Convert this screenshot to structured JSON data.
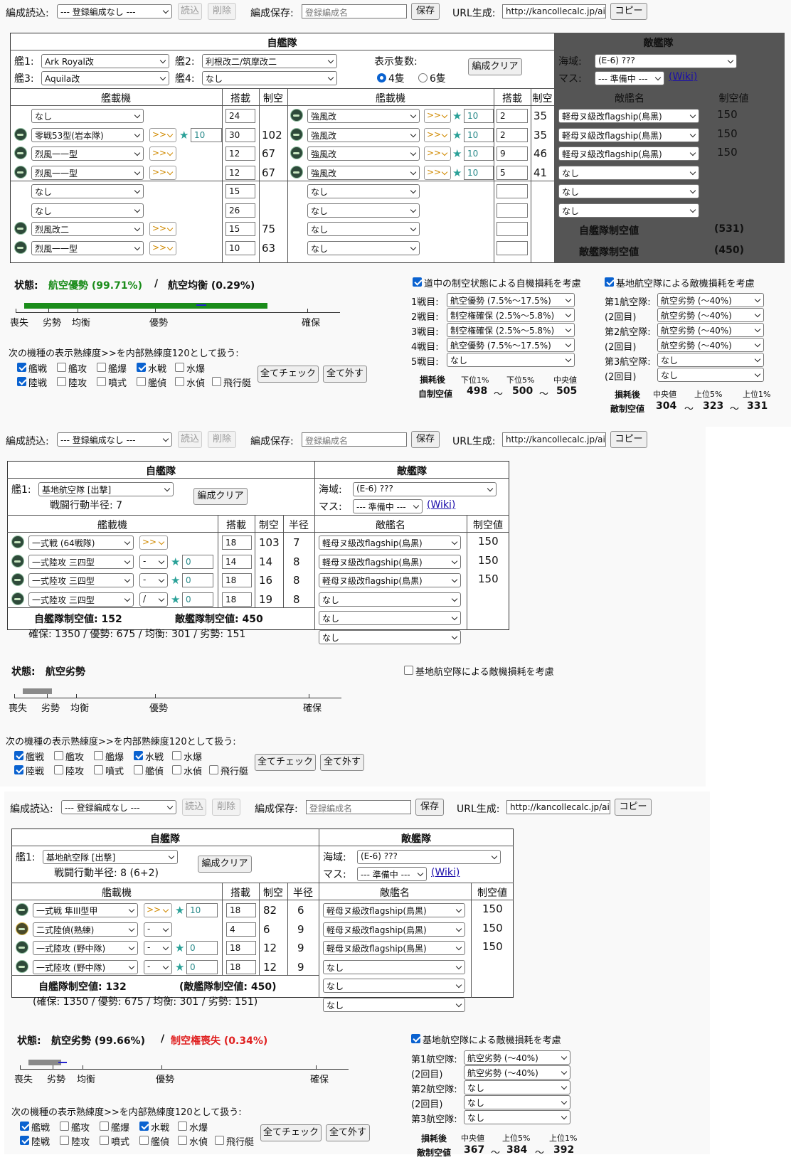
{
  "top_bar": {
    "load_label": "編成読込:",
    "load_select": "--- 登録編成なし ---",
    "read": "読込",
    "delete": "削除",
    "save_label": "編成保存:",
    "save_placeholder": "登録編成名",
    "save": "保存",
    "url_label": "URL生成:",
    "url_value": "http://kancollecalc.jp/air_",
    "copy": "コピー"
  },
  "common": {
    "own": "自艦隊",
    "enemy": "敵艦隊",
    "equip": "艦載機",
    "slot": "搭載",
    "ap": "制空",
    "radius": "半径",
    "enemy_name": "敵艦名",
    "enemy_ap": "制空値",
    "area_label": "海域:",
    "area": "(E-6) ???",
    "cell_label": "マス:",
    "cell": "--- 準備中 ---",
    "wiki": "(Wiki)",
    "clear": "編成クリア",
    "prof_note": "次の機種の表示熟練度>>を内部熟練度120として扱う:",
    "check_all": "全てチェック",
    "uncheck_all": "全て外す",
    "status_label": "状態:",
    "star": "★",
    "lvl_max": ">>",
    "lvl_none": "-",
    "lvl_one": "/"
  },
  "checkboxes": [
    {
      "label": "艦戦",
      "on": true
    },
    {
      "label": "艦攻",
      "on": false
    },
    {
      "label": "艦爆",
      "on": false
    },
    {
      "label": "水戦",
      "on": true
    },
    {
      "label": "水爆",
      "on": false
    },
    {
      "label": "陸戦",
      "on": true
    },
    {
      "label": "陸攻",
      "on": false
    },
    {
      "label": "噴式",
      "on": false
    },
    {
      "label": "艦偵",
      "on": false
    },
    {
      "label": "水偵",
      "on": false
    },
    {
      "label": "飛行艇",
      "on": false
    }
  ],
  "scale_labels": [
    "喪失",
    "劣勢",
    "均衡",
    "優勢",
    "確保"
  ],
  "panel1": {
    "ship1_label": "艦1:",
    "ship1": "Ark Royal改",
    "ship2_label": "艦2:",
    "ship2": "利根改二/筑摩改二",
    "ship3_label": "艦3:",
    "ship3": "Aquila改",
    "ship4_label": "艦4:",
    "ship4": "なし",
    "display_count": "表示隻数:",
    "opt4": "4隻",
    "opt6": "6隻",
    "left_rows": [
      {
        "eq": "なし",
        "slot": "24",
        "ap": ""
      },
      {
        "eq": "零戦53型(岩本隊)",
        "slot": "30",
        "ap": "102",
        "lv": ">>",
        "star": "10"
      },
      {
        "eq": "烈風一一型",
        "slot": "12",
        "ap": "67",
        "lv": ">>"
      },
      {
        "eq": "烈風一一型",
        "slot": "12",
        "ap": "67",
        "lv": ">>"
      },
      {
        "eq": "なし",
        "slot": "15",
        "ap": ""
      },
      {
        "eq": "なし",
        "slot": "26",
        "ap": ""
      },
      {
        "eq": "烈風改二",
        "slot": "15",
        "ap": "75",
        "lv": ">>"
      },
      {
        "eq": "烈風一一型",
        "slot": "10",
        "ap": "63",
        "lv": ">>"
      }
    ],
    "mid_rows": [
      {
        "eq": "強風改",
        "slot": "2",
        "ap": "35",
        "lv": ">>",
        "star": "10"
      },
      {
        "eq": "強風改",
        "slot": "2",
        "ap": "35",
        "lv": ">>",
        "star": "10"
      },
      {
        "eq": "強風改",
        "slot": "9",
        "ap": "46",
        "lv": ">>",
        "star": "10"
      },
      {
        "eq": "強風改",
        "slot": "5",
        "ap": "41",
        "lv": ">>",
        "star": "10"
      },
      {
        "eq": "なし",
        "slot": "",
        "ap": ""
      },
      {
        "eq": "なし",
        "slot": "",
        "ap": ""
      },
      {
        "eq": "なし",
        "slot": "",
        "ap": ""
      },
      {
        "eq": "なし",
        "slot": "",
        "ap": ""
      }
    ],
    "enemy_rows": [
      {
        "name": "軽母ヌ級改flagship(鳥黒)",
        "ap": "150"
      },
      {
        "name": "軽母ヌ級改flagship(鳥黒)",
        "ap": "150"
      },
      {
        "name": "軽母ヌ級改flagship(鳥黒)",
        "ap": "150"
      },
      {
        "name": "なし",
        "ap": ""
      },
      {
        "name": "なし",
        "ap": ""
      },
      {
        "name": "なし",
        "ap": ""
      }
    ],
    "own_total_label": "自艦隊制空値",
    "own_total": "(531)",
    "enemy_total_label": "敵艦隊制空値",
    "enemy_total": "(450)",
    "status_green": "航空優勢 (99.71%)",
    "status_sep": " / ",
    "status_dark": "航空均衡 (0.29%)",
    "progress": 0.75,
    "route_check": "道中の制空状態による自機損耗を考慮",
    "route_rows": [
      {
        "l": "1戦目:",
        "v": "航空優勢 (7.5%〜17.5%)"
      },
      {
        "l": "2戦目:",
        "v": "制空権確保 (2.5%〜5.8%)"
      },
      {
        "l": "3戦目:",
        "v": "制空権確保 (2.5%〜5.8%)"
      },
      {
        "l": "4戦目:",
        "v": "航空優勢 (7.5%〜17.5%)"
      },
      {
        "l": "5戦目:",
        "v": "なし"
      }
    ],
    "loss_label": "損耗後",
    "own_after": "自制空値",
    "p1": "下位1%",
    "p5": "下位5%",
    "med": "中央値",
    "v1": "498",
    "v2": "500",
    "v3": "505",
    "tilde": "〜",
    "base_check": "基地航空隊による敵機損耗を考慮",
    "base_rows": [
      {
        "l": "第1航空隊:",
        "v": "航空劣勢 (〜40%)"
      },
      {
        "l": "(2回目)",
        "v": "航空劣勢 (〜40%)"
      },
      {
        "l": "第2航空隊:",
        "v": "航空劣勢 (〜40%)"
      },
      {
        "l": "(2回目)",
        "v": "航空劣勢 (〜40%)"
      },
      {
        "l": "第3航空隊:",
        "v": "なし"
      },
      {
        "l": "(2回目)",
        "v": "なし"
      }
    ],
    "enemy_after": "敵制空値",
    "u5": "上位5%",
    "u1": "上位1%",
    "e1": "304",
    "e2": "323",
    "e3": "331"
  },
  "panel2": {
    "ship1_label": "艦1:",
    "ship1": "基地航空隊 [出撃]",
    "radius_text": "戦闘行動半径: 7",
    "rows": [
      {
        "eq": "一式戦 (64戦隊)",
        "lv": ">>",
        "slot": "18",
        "ap": "103",
        "r": "7"
      },
      {
        "eq": "一式陸攻 三四型",
        "lv": "-",
        "star": "0",
        "slot": "14",
        "ap": "14",
        "r": "8"
      },
      {
        "eq": "一式陸攻 三四型",
        "lv": "-",
        "star": "0",
        "slot": "18",
        "ap": "16",
        "r": "8"
      },
      {
        "eq": "一式陸攻 三四型",
        "lv": "/",
        "star": "0",
        "slot": "18",
        "ap": "19",
        "r": "8"
      }
    ],
    "enemy_rows": [
      {
        "name": "軽母ヌ級改flagship(鳥黒)",
        "ap": "150"
      },
      {
        "name": "軽母ヌ級改flagship(鳥黒)",
        "ap": "150"
      },
      {
        "name": "軽母ヌ級改flagship(鳥黒)",
        "ap": "150"
      },
      {
        "name": "なし",
        "ap": ""
      },
      {
        "name": "なし",
        "ap": ""
      },
      {
        "name": "なし",
        "ap": ""
      }
    ],
    "own_ap": "自艦隊制空値: 152",
    "enemy_ap": "敵艦隊制空値: 450",
    "thresholds": "確保: 1350 / 優勢: 675 / 均衡: 301 / 劣勢: 151",
    "status": "航空劣勢",
    "progress": 0.09,
    "base_check": "基地航空隊による敵機損耗を考慮"
  },
  "panel3": {
    "ship1_label": "艦1:",
    "ship1": "基地航空隊 [出撃]",
    "radius_text": "戦闘行動半径: 8 (6+2)",
    "rows": [
      {
        "eq": "一式戦 隼III型甲",
        "lv": ">>",
        "star": "10",
        "slot": "18",
        "ap": "82",
        "r": "6"
      },
      {
        "eq": "二式陸偵(熟練)",
        "lv": "-",
        "slot": "4",
        "ap": "6",
        "r": "9",
        "y": true
      },
      {
        "eq": "一式陸攻 (野中隊)",
        "lv": "-",
        "star": "0",
        "slot": "18",
        "ap": "12",
        "r": "9"
      },
      {
        "eq": "一式陸攻 (野中隊)",
        "lv": "-",
        "star": "0",
        "slot": "18",
        "ap": "12",
        "r": "9"
      }
    ],
    "enemy_rows": [
      {
        "name": "軽母ヌ級改flagship(鳥黒)",
        "ap": "150"
      },
      {
        "name": "軽母ヌ級改flagship(鳥黒)",
        "ap": "150"
      },
      {
        "name": "軽母ヌ級改flagship(鳥黒)",
        "ap": "150"
      },
      {
        "name": "なし",
        "ap": ""
      },
      {
        "name": "なし",
        "ap": ""
      },
      {
        "name": "なし",
        "ap": ""
      }
    ],
    "own_ap": "自艦隊制空値: 132",
    "enemy_ap": "(敵艦隊制空値: 450)",
    "thresholds": "(確保: 1350 / 優勢: 675 / 均衡: 301 / 劣勢: 151)",
    "status_dark": "航空劣勢 (99.66%)",
    "status_sep": " / ",
    "status_red": "制空権喪失 (0.34%)",
    "progress": 0.1,
    "base_check": "基地航空隊による敵機損耗を考慮",
    "base_rows": [
      {
        "l": "第1航空隊:",
        "v": "航空劣勢 (〜40%)"
      },
      {
        "l": "(2回目)",
        "v": "航空劣勢 (〜40%)"
      },
      {
        "l": "第2航空隊:",
        "v": "なし"
      },
      {
        "l": "(2回目)",
        "v": "なし"
      },
      {
        "l": "第3航空隊:",
        "v": "なし"
      }
    ],
    "loss_label": "損耗後",
    "enemy_after": "敵制空値",
    "med": "中央値",
    "u5": "上位5%",
    "u1": "上位1%",
    "e1": "367",
    "e2": "384",
    "e3": "392",
    "tilde": "〜"
  }
}
